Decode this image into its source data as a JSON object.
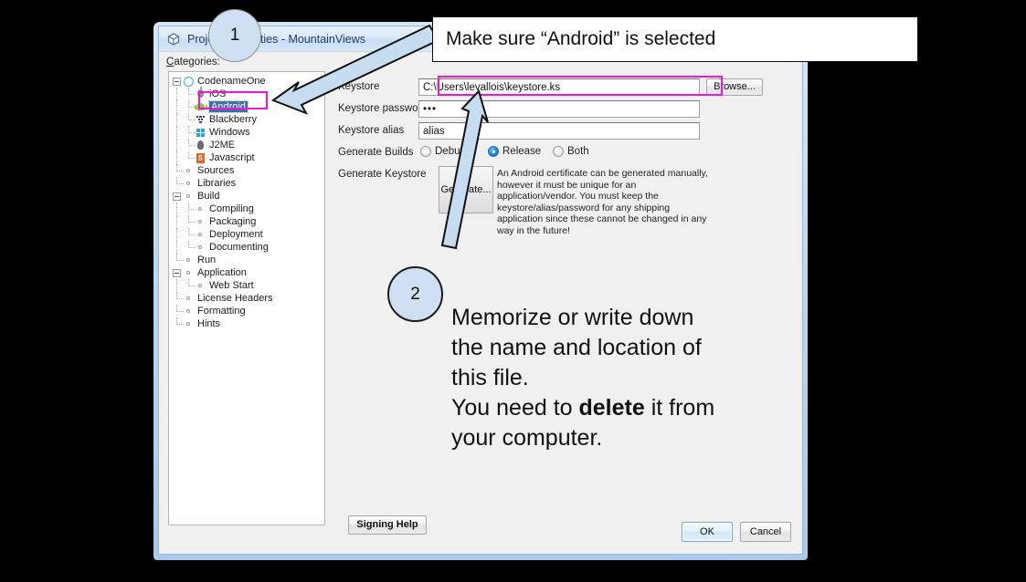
{
  "window": {
    "title": "Project Properties - MountainViews",
    "icon": "cube-icon",
    "categories_label": "Categories:"
  },
  "tree": {
    "nodes": [
      {
        "label": "CodenameOne",
        "level": 0,
        "icon": "codenameone-icon",
        "expander": "minus",
        "selected": false
      },
      {
        "label": "iOS",
        "level": 1,
        "icon": "apple-icon",
        "expander": "none",
        "selected": false
      },
      {
        "label": "Android",
        "level": 1,
        "icon": "android-icon",
        "expander": "none",
        "selected": true
      },
      {
        "label": "Blackberry",
        "level": 1,
        "icon": "blackberry-icon",
        "expander": "none",
        "selected": false
      },
      {
        "label": "Windows",
        "level": 1,
        "icon": "windows-icon",
        "expander": "none",
        "selected": false
      },
      {
        "label": "J2ME",
        "level": 1,
        "icon": "j2me-icon",
        "expander": "none",
        "selected": false
      },
      {
        "label": "Javascript",
        "level": 1,
        "icon": "javascript-icon",
        "expander": "none",
        "selected": false
      },
      {
        "label": "Sources",
        "level": 0,
        "icon": "bullet-icon",
        "expander": "none",
        "selected": false
      },
      {
        "label": "Libraries",
        "level": 0,
        "icon": "bullet-icon",
        "expander": "none",
        "selected": false
      },
      {
        "label": "Build",
        "level": 0,
        "icon": "bullet-icon",
        "expander": "minus",
        "selected": false
      },
      {
        "label": "Compiling",
        "level": 1,
        "icon": "bullet-icon",
        "expander": "none",
        "selected": false
      },
      {
        "label": "Packaging",
        "level": 1,
        "icon": "bullet-icon",
        "expander": "none",
        "selected": false
      },
      {
        "label": "Deployment",
        "level": 1,
        "icon": "bullet-icon",
        "expander": "none",
        "selected": false
      },
      {
        "label": "Documenting",
        "level": 1,
        "icon": "bullet-icon",
        "expander": "none",
        "selected": false
      },
      {
        "label": "Run",
        "level": 0,
        "icon": "bullet-icon",
        "expander": "none",
        "selected": false
      },
      {
        "label": "Application",
        "level": 0,
        "icon": "bullet-icon",
        "expander": "minus",
        "selected": false
      },
      {
        "label": "Web Start",
        "level": 1,
        "icon": "bullet-icon",
        "expander": "none",
        "selected": false
      },
      {
        "label": "License Headers",
        "level": 0,
        "icon": "bullet-icon",
        "expander": "none",
        "selected": false
      },
      {
        "label": "Formatting",
        "level": 0,
        "icon": "bullet-icon",
        "expander": "none",
        "selected": false
      },
      {
        "label": "Hints",
        "level": 0,
        "icon": "bullet-icon",
        "expander": "none",
        "selected": false
      }
    ]
  },
  "form": {
    "keystore": {
      "label": "Keystore",
      "value": "C:\\Users\\levallois\\keystore.ks",
      "browse_label": "Browse..."
    },
    "keystore_password": {
      "label": "Keystore password",
      "value": "•••"
    },
    "keystore_alias": {
      "label": "Keystore alias",
      "value": "alias"
    },
    "generate_builds": {
      "label": "Generate Builds",
      "options": [
        {
          "label": "Debug",
          "selected": false
        },
        {
          "label": "Release",
          "selected": true
        },
        {
          "label": "Both",
          "selected": false
        }
      ]
    },
    "generate_keystore": {
      "label": "Generate Keystore",
      "button_label": "Generate...",
      "note": "An Android certificate can be generated manually, however it must be unique for an application/vendor. You must keep the keystore/alias/password for any shipping application since these cannot be changed in any way in the future!"
    },
    "signing_help_label": "Signing Help"
  },
  "buttons": {
    "ok": "OK",
    "cancel": "Cancel"
  },
  "annotations": {
    "step1_number": "1",
    "step2_number": "2",
    "note_box_text": "Make sure “Android” is selected",
    "instruction_line1": "Memorize or write down",
    "instruction_line2": "the name and location of",
    "instruction_line3": "this file.",
    "instruction_line4a": "You need to ",
    "instruction_line4b": "delete",
    "instruction_line4c": " it from",
    "instruction_line5": "your computer."
  },
  "colors": {
    "highlight": "#ef16d8",
    "arrow_fill": "#c6dcf0",
    "callout_fill": "#cfe0f2",
    "selection": "#3f6fa8",
    "background": "#000000"
  }
}
